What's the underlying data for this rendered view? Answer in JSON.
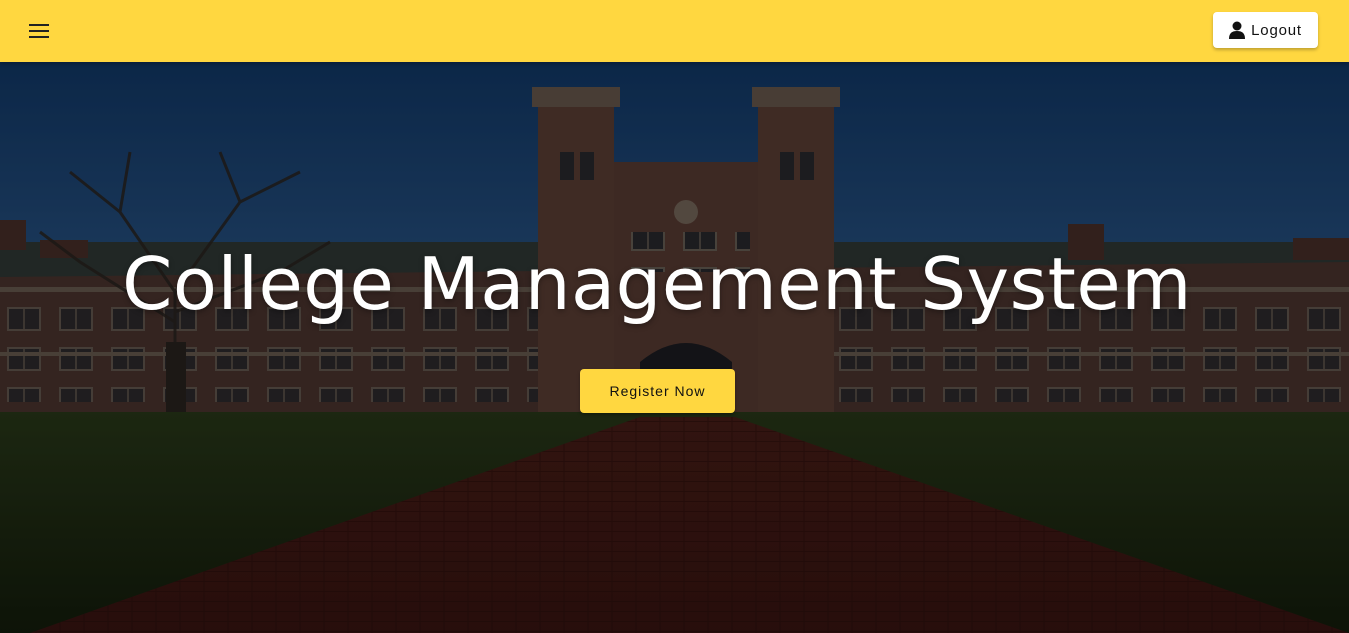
{
  "colors": {
    "accent": "#FFD740",
    "button_light": "#ffffff"
  },
  "header": {
    "menu_icon": "hamburger-menu-icon",
    "logout_icon": "person-icon",
    "logout_label": "Logout"
  },
  "hero": {
    "title": "College Management System",
    "register_label": "Register Now"
  }
}
